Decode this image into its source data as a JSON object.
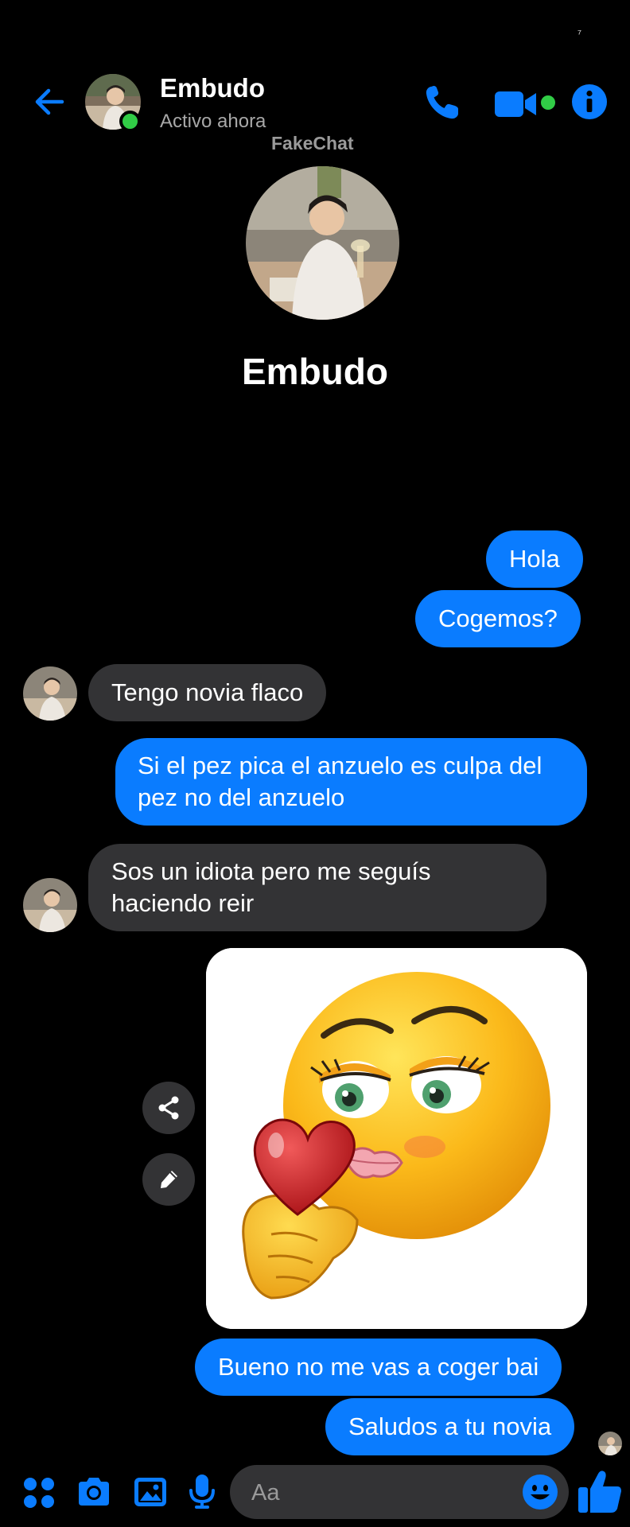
{
  "status_bar": {
    "indicator": "⁷"
  },
  "header": {
    "contact_name": "Embudo",
    "status": "Activo ahora",
    "watermark": "FakeChat",
    "accent_color": "#0a7cff",
    "online_color": "#31cc46"
  },
  "profile": {
    "name": "Embudo"
  },
  "messages": [
    {
      "from": "me",
      "text": "Hola"
    },
    {
      "from": "me",
      "text": "Cogemos?"
    },
    {
      "from": "them",
      "text": "Tengo novia flaco"
    },
    {
      "from": "me",
      "text": "Si el pez pica el anzuelo es culpa del pez no del anzuelo"
    },
    {
      "from": "them",
      "text": "Sos un idiota pero me seguís haciendo reir"
    },
    {
      "from": "me",
      "type": "image",
      "content": "kiss-emoji-sticker"
    },
    {
      "from": "me",
      "text": "Bueno no me vas a coger bai"
    },
    {
      "from": "me",
      "text": "Saludos a tu novia"
    }
  ],
  "composer": {
    "placeholder": "Aa",
    "icons": [
      "apps-icon",
      "camera-icon",
      "gallery-icon",
      "microphone-icon",
      "emoji-icon",
      "thumbs-up-icon"
    ]
  },
  "colors": {
    "sent_bubble": "#0a7cff",
    "received_bubble": "#333335",
    "background": "#000000"
  }
}
